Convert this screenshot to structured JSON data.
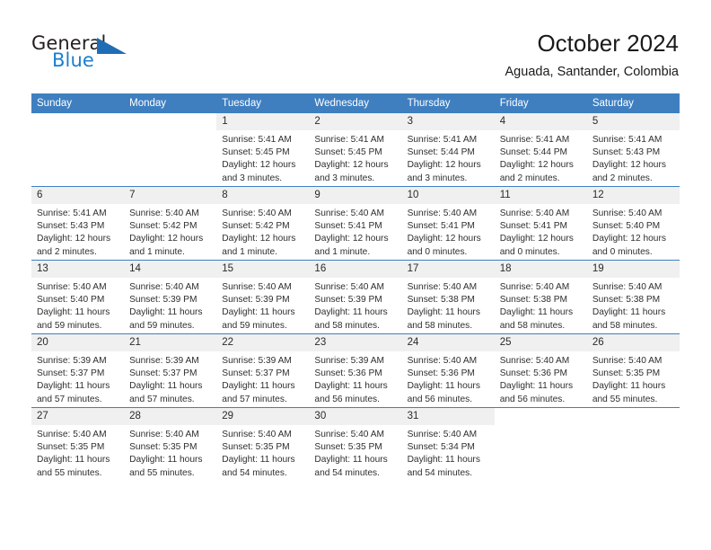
{
  "brand": {
    "word_top": "General",
    "word_bottom": "Blue",
    "triangle_icon": "triangle-icon",
    "color_dark": "#231f20",
    "color_blue": "#1b7fd0"
  },
  "header": {
    "title": "October 2024",
    "subtitle": "Aguada, Santander, Colombia"
  },
  "theme": {
    "header_blue": "#3f7fc0",
    "daynum_band": "#f0f0f0",
    "text": "#2e2e2e"
  },
  "weekday_headers": [
    "Sunday",
    "Monday",
    "Tuesday",
    "Wednesday",
    "Thursday",
    "Friday",
    "Saturday"
  ],
  "weeks": [
    [
      {
        "day": "",
        "blank": true,
        "sunrise": "",
        "sunset": "",
        "daylight_1": "",
        "daylight_2": ""
      },
      {
        "day": "",
        "blank": true,
        "sunrise": "",
        "sunset": "",
        "daylight_1": "",
        "daylight_2": ""
      },
      {
        "day": "1",
        "sunrise": "Sunrise: 5:41 AM",
        "sunset": "Sunset: 5:45 PM",
        "daylight_1": "Daylight: 12 hours",
        "daylight_2": "and 3 minutes."
      },
      {
        "day": "2",
        "sunrise": "Sunrise: 5:41 AM",
        "sunset": "Sunset: 5:45 PM",
        "daylight_1": "Daylight: 12 hours",
        "daylight_2": "and 3 minutes."
      },
      {
        "day": "3",
        "sunrise": "Sunrise: 5:41 AM",
        "sunset": "Sunset: 5:44 PM",
        "daylight_1": "Daylight: 12 hours",
        "daylight_2": "and 3 minutes."
      },
      {
        "day": "4",
        "sunrise": "Sunrise: 5:41 AM",
        "sunset": "Sunset: 5:44 PM",
        "daylight_1": "Daylight: 12 hours",
        "daylight_2": "and 2 minutes."
      },
      {
        "day": "5",
        "sunrise": "Sunrise: 5:41 AM",
        "sunset": "Sunset: 5:43 PM",
        "daylight_1": "Daylight: 12 hours",
        "daylight_2": "and 2 minutes."
      }
    ],
    [
      {
        "day": "6",
        "sunrise": "Sunrise: 5:41 AM",
        "sunset": "Sunset: 5:43 PM",
        "daylight_1": "Daylight: 12 hours",
        "daylight_2": "and 2 minutes."
      },
      {
        "day": "7",
        "sunrise": "Sunrise: 5:40 AM",
        "sunset": "Sunset: 5:42 PM",
        "daylight_1": "Daylight: 12 hours",
        "daylight_2": "and 1 minute."
      },
      {
        "day": "8",
        "sunrise": "Sunrise: 5:40 AM",
        "sunset": "Sunset: 5:42 PM",
        "daylight_1": "Daylight: 12 hours",
        "daylight_2": "and 1 minute."
      },
      {
        "day": "9",
        "sunrise": "Sunrise: 5:40 AM",
        "sunset": "Sunset: 5:41 PM",
        "daylight_1": "Daylight: 12 hours",
        "daylight_2": "and 1 minute."
      },
      {
        "day": "10",
        "sunrise": "Sunrise: 5:40 AM",
        "sunset": "Sunset: 5:41 PM",
        "daylight_1": "Daylight: 12 hours",
        "daylight_2": "and 0 minutes."
      },
      {
        "day": "11",
        "sunrise": "Sunrise: 5:40 AM",
        "sunset": "Sunset: 5:41 PM",
        "daylight_1": "Daylight: 12 hours",
        "daylight_2": "and 0 minutes."
      },
      {
        "day": "12",
        "sunrise": "Sunrise: 5:40 AM",
        "sunset": "Sunset: 5:40 PM",
        "daylight_1": "Daylight: 12 hours",
        "daylight_2": "and 0 minutes."
      }
    ],
    [
      {
        "day": "13",
        "sunrise": "Sunrise: 5:40 AM",
        "sunset": "Sunset: 5:40 PM",
        "daylight_1": "Daylight: 11 hours",
        "daylight_2": "and 59 minutes."
      },
      {
        "day": "14",
        "sunrise": "Sunrise: 5:40 AM",
        "sunset": "Sunset: 5:39 PM",
        "daylight_1": "Daylight: 11 hours",
        "daylight_2": "and 59 minutes."
      },
      {
        "day": "15",
        "sunrise": "Sunrise: 5:40 AM",
        "sunset": "Sunset: 5:39 PM",
        "daylight_1": "Daylight: 11 hours",
        "daylight_2": "and 59 minutes."
      },
      {
        "day": "16",
        "sunrise": "Sunrise: 5:40 AM",
        "sunset": "Sunset: 5:39 PM",
        "daylight_1": "Daylight: 11 hours",
        "daylight_2": "and 58 minutes."
      },
      {
        "day": "17",
        "sunrise": "Sunrise: 5:40 AM",
        "sunset": "Sunset: 5:38 PM",
        "daylight_1": "Daylight: 11 hours",
        "daylight_2": "and 58 minutes."
      },
      {
        "day": "18",
        "sunrise": "Sunrise: 5:40 AM",
        "sunset": "Sunset: 5:38 PM",
        "daylight_1": "Daylight: 11 hours",
        "daylight_2": "and 58 minutes."
      },
      {
        "day": "19",
        "sunrise": "Sunrise: 5:40 AM",
        "sunset": "Sunset: 5:38 PM",
        "daylight_1": "Daylight: 11 hours",
        "daylight_2": "and 58 minutes."
      }
    ],
    [
      {
        "day": "20",
        "sunrise": "Sunrise: 5:39 AM",
        "sunset": "Sunset: 5:37 PM",
        "daylight_1": "Daylight: 11 hours",
        "daylight_2": "and 57 minutes."
      },
      {
        "day": "21",
        "sunrise": "Sunrise: 5:39 AM",
        "sunset": "Sunset: 5:37 PM",
        "daylight_1": "Daylight: 11 hours",
        "daylight_2": "and 57 minutes."
      },
      {
        "day": "22",
        "sunrise": "Sunrise: 5:39 AM",
        "sunset": "Sunset: 5:37 PM",
        "daylight_1": "Daylight: 11 hours",
        "daylight_2": "and 57 minutes."
      },
      {
        "day": "23",
        "sunrise": "Sunrise: 5:39 AM",
        "sunset": "Sunset: 5:36 PM",
        "daylight_1": "Daylight: 11 hours",
        "daylight_2": "and 56 minutes."
      },
      {
        "day": "24",
        "sunrise": "Sunrise: 5:40 AM",
        "sunset": "Sunset: 5:36 PM",
        "daylight_1": "Daylight: 11 hours",
        "daylight_2": "and 56 minutes."
      },
      {
        "day": "25",
        "sunrise": "Sunrise: 5:40 AM",
        "sunset": "Sunset: 5:36 PM",
        "daylight_1": "Daylight: 11 hours",
        "daylight_2": "and 56 minutes."
      },
      {
        "day": "26",
        "sunrise": "Sunrise: 5:40 AM",
        "sunset": "Sunset: 5:35 PM",
        "daylight_1": "Daylight: 11 hours",
        "daylight_2": "and 55 minutes."
      }
    ],
    [
      {
        "day": "27",
        "sunrise": "Sunrise: 5:40 AM",
        "sunset": "Sunset: 5:35 PM",
        "daylight_1": "Daylight: 11 hours",
        "daylight_2": "and 55 minutes."
      },
      {
        "day": "28",
        "sunrise": "Sunrise: 5:40 AM",
        "sunset": "Sunset: 5:35 PM",
        "daylight_1": "Daylight: 11 hours",
        "daylight_2": "and 55 minutes."
      },
      {
        "day": "29",
        "sunrise": "Sunrise: 5:40 AM",
        "sunset": "Sunset: 5:35 PM",
        "daylight_1": "Daylight: 11 hours",
        "daylight_2": "and 54 minutes."
      },
      {
        "day": "30",
        "sunrise": "Sunrise: 5:40 AM",
        "sunset": "Sunset: 5:35 PM",
        "daylight_1": "Daylight: 11 hours",
        "daylight_2": "and 54 minutes."
      },
      {
        "day": "31",
        "sunrise": "Sunrise: 5:40 AM",
        "sunset": "Sunset: 5:34 PM",
        "daylight_1": "Daylight: 11 hours",
        "daylight_2": "and 54 minutes."
      },
      {
        "day": "",
        "blank": true,
        "sunrise": "",
        "sunset": "",
        "daylight_1": "",
        "daylight_2": ""
      },
      {
        "day": "",
        "blank": true,
        "sunrise": "",
        "sunset": "",
        "daylight_1": "",
        "daylight_2": ""
      }
    ]
  ]
}
